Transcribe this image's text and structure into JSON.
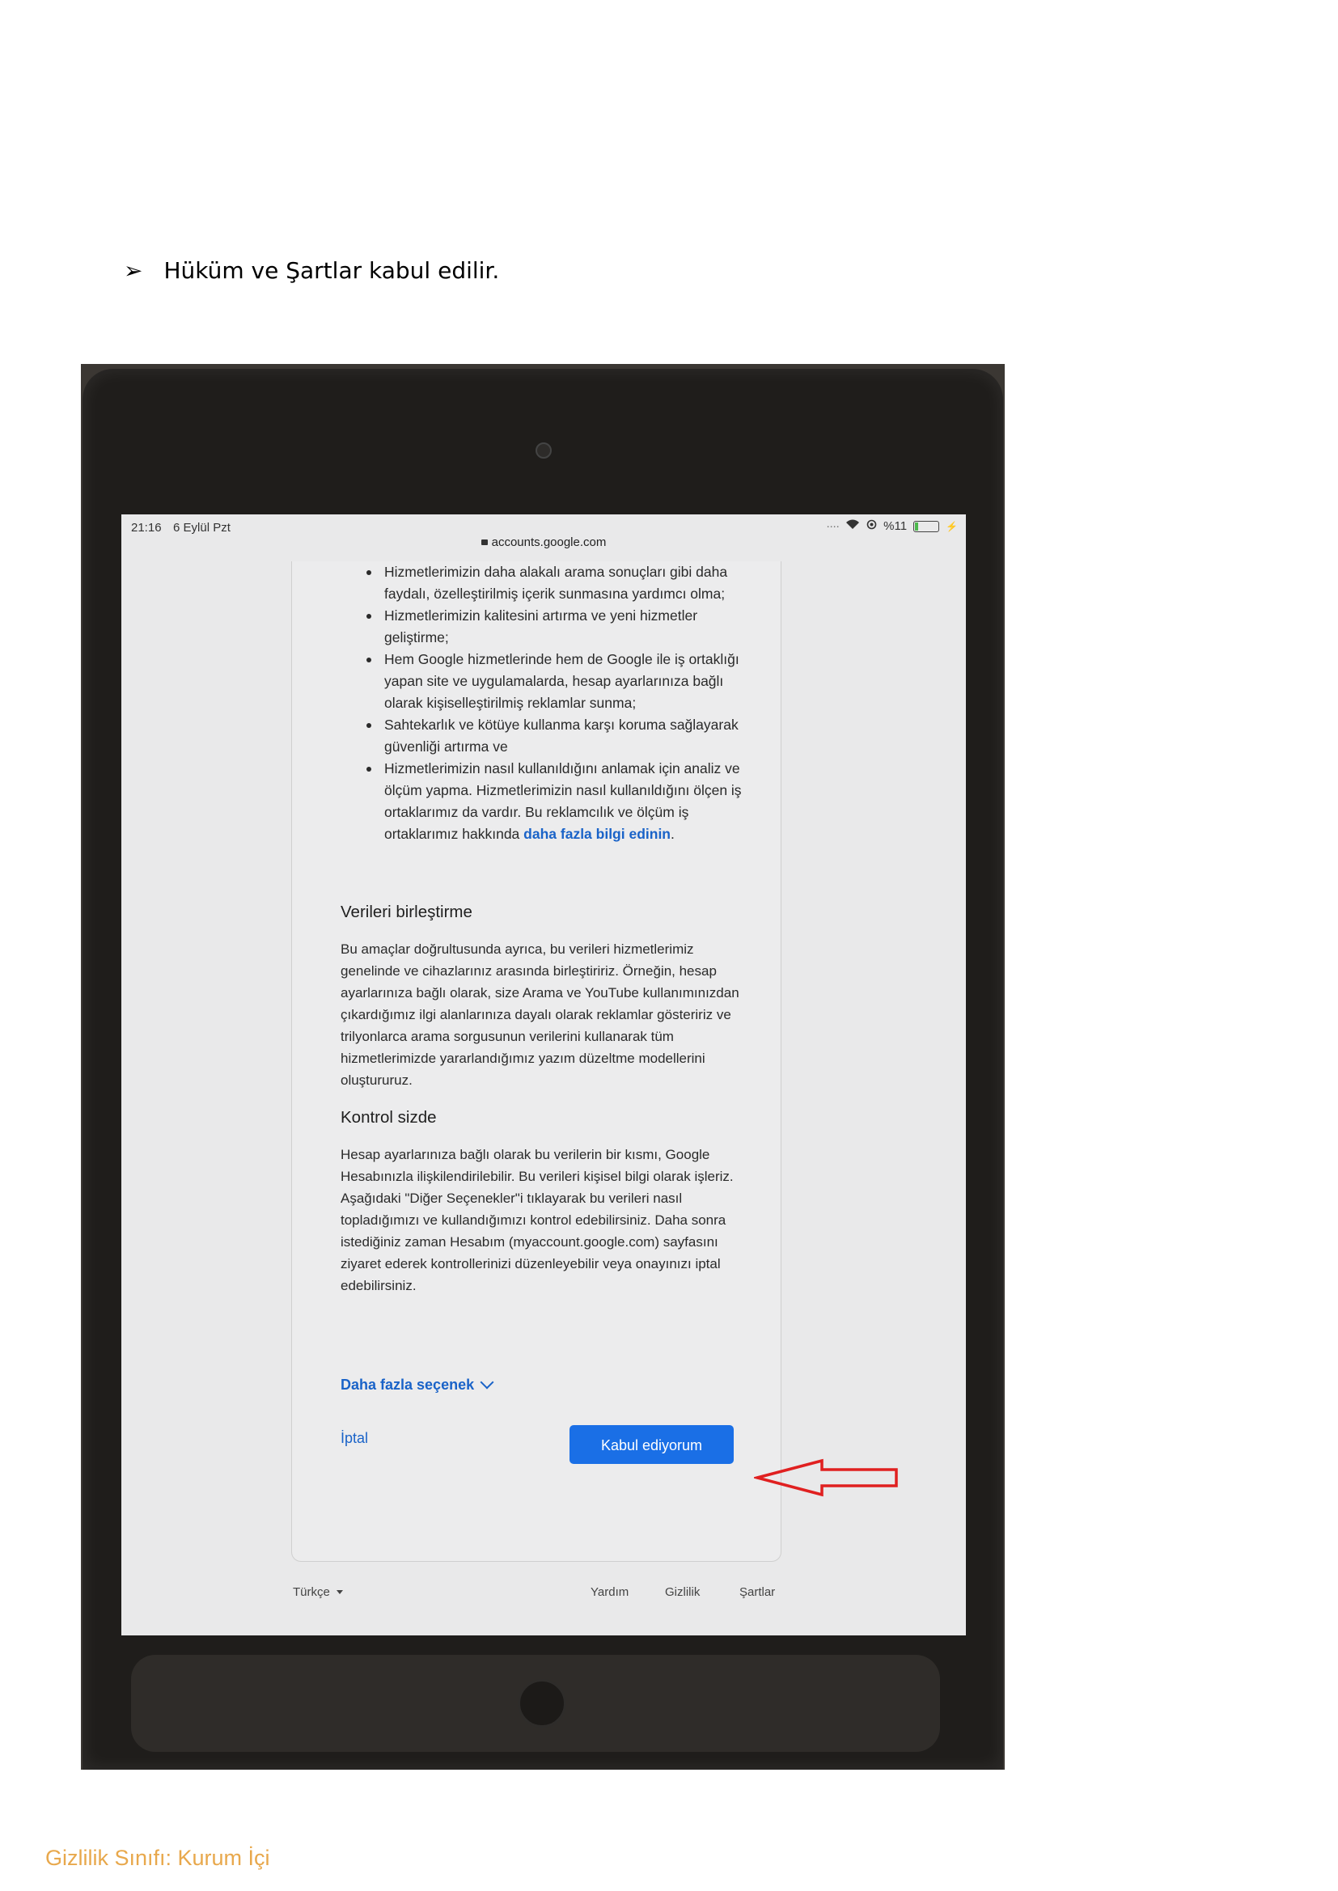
{
  "document": {
    "step_text": "Hüküm ve Şartlar kabul edilir.",
    "classification": "Gizlilik Sınıfı: Kurum İçi"
  },
  "status_bar": {
    "time": "21:16",
    "date": "6 Eylül Pzt",
    "battery": "%11",
    "url": "accounts.google.com"
  },
  "content": {
    "bullets": [
      "Hizmetlerimizin daha alakalı arama sonuçları gibi daha faydalı, özelleştirilmiş içerik sunmasına yardımcı olma;",
      "Hizmetlerimizin kalitesini artırma ve yeni hizmetler geliştirme;",
      "Hem Google hizmetlerinde hem de Google ile iş ortaklığı yapan site ve uygulamalarda, hesap ayarlarınıza bağlı olarak kişiselleştirilmiş reklamlar sunma;",
      "Sahtekarlık ve kötüye kullanma karşı koruma sağlayarak güvenliği artırma ve",
      "Hizmetlerimizin nasıl kullanıldığını anlamak için analiz ve ölçüm yapma. Hizmetlerimizin nasıl kullanıldığını ölçen iş ortaklarımız da vardır. Bu reklamcılık ve ölçüm iş ortaklarımız hakkında"
    ],
    "learn_more_link": "daha fazla bilgi edinin",
    "learn_more_period": ".",
    "section1_title": "Verileri birleştirme",
    "section1_body": "Bu amaçlar doğrultusunda ayrıca, bu verileri hizmetlerimiz genelinde ve cihazlarınız arasında birleştiririz. Örneğin, hesap ayarlarınıza bağlı olarak, size Arama ve YouTube kullanımınızdan çıkardığımız ilgi alanlarınıza dayalı olarak reklamlar gösteririz ve trilyonlarca arama sorgusunun verilerini kullanarak tüm hizmetlerimizde yararlandığımız yazım düzeltme modellerini oluştururuz.",
    "section2_title": "Kontrol sizde",
    "section2_body": "Hesap ayarlarınıza bağlı olarak bu verilerin bir kısmı, Google Hesabınızla ilişkilendirilebilir. Bu verileri kişisel bilgi olarak işleriz. Aşağıdaki \"Diğer Seçenekler\"i tıklayarak bu verileri nasıl topladığımızı ve kullandığımızı kontrol edebilirsiniz. Daha sonra istediğiniz zaman Hesabım (myaccount.google.com) sayfasını ziyaret ederek kontrollerinizi düzenleyebilir veya onayınızı iptal edebilirsiniz.",
    "more_options": "Daha fazla seçenek",
    "cancel": "İptal",
    "accept": "Kabul ediyorum"
  },
  "footer": {
    "language": "Türkçe",
    "help": "Yardım",
    "privacy": "Gizlilik",
    "terms": "Şartlar"
  },
  "colors": {
    "link_blue": "#1a63c8",
    "button_blue": "#1a6fe6",
    "annotation_red": "#e02020",
    "classification_orange": "#e8a84c"
  }
}
